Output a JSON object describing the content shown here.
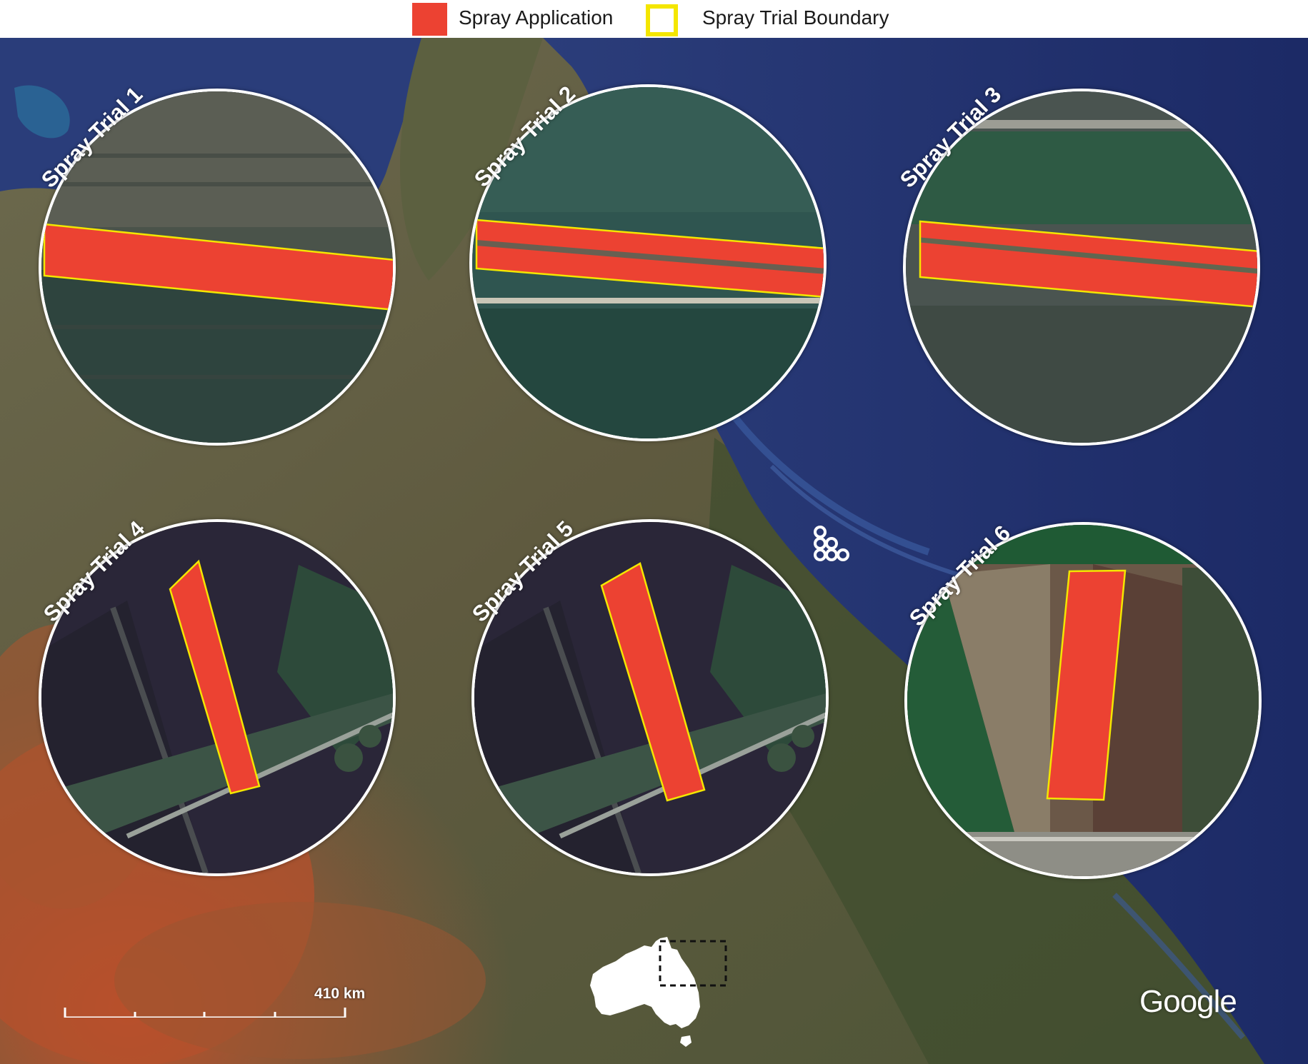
{
  "legend": {
    "spray_application": "Spray Application",
    "spray_trial_boundary": "Spray Trial Boundary",
    "colors": {
      "spray": "#ec4232",
      "boundary": "#f4e600"
    }
  },
  "trials": [
    {
      "label": "Spray Trial 1"
    },
    {
      "label": "Spray Trial 2"
    },
    {
      "label": "Spray Trial 3"
    },
    {
      "label": "Spray Trial 4"
    },
    {
      "label": "Spray Trial 5"
    },
    {
      "label": "Spray Trial 6"
    }
  ],
  "scale_bar": {
    "label": "410 km"
  },
  "attribution": "Google",
  "icons": {
    "site_marker": "cluster-dots-icon",
    "inset": "australia-map-icon"
  }
}
